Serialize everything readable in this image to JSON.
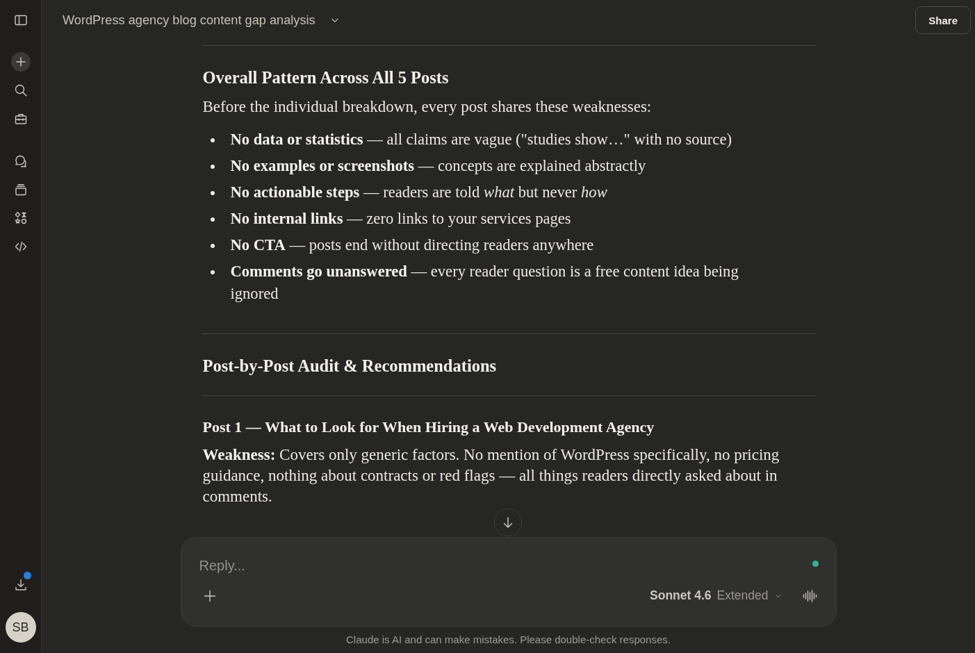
{
  "sidebar": {
    "download_notification": true,
    "avatar": {
      "initials": "SB"
    }
  },
  "header": {
    "title": "WordPress agency blog content gap analysis",
    "share_button": "Share"
  },
  "content": [
    {
      "kind": "rule"
    },
    {
      "kind": "heading",
      "text": "Overall Pattern Across All 5 Posts"
    },
    {
      "kind": "paragraph",
      "text": "Before the individual breakdown, every post shares these weaknesses:"
    },
    {
      "kind": "bullets",
      "items": [
        "**No data or statistics** — all claims are vague (\"studies show…\" with no source)",
        "**No examples or screenshots** — concepts are explained abstractly",
        "**No actionable steps** — readers are told *what* but never *how*",
        "**No internal links** — zero links to your services pages",
        "**No CTA** — posts end without directing readers anywhere",
        "**Comments go unanswered** — every reader question is a free content idea being ignored"
      ]
    },
    {
      "kind": "rule"
    },
    {
      "kind": "heading",
      "text": "Post-by-Post Audit & Recommendations"
    },
    {
      "kind": "rule"
    },
    {
      "kind": "subheading",
      "text": "Post 1 — What to Look for When Hiring a Web Development Agency"
    },
    {
      "kind": "paragraph",
      "text": "**Weakness:** Covers only generic factors. No mention of WordPress specifically, no pricing guidance, nothing about contracts or red flags — all things readers directly asked about in comments."
    }
  ],
  "composer": {
    "placeholder": "Reply...",
    "model": "Sonnet 4.6",
    "mode": "Extended"
  },
  "disclaimer": "Claude is AI and can make mistakes. Please double-check responses."
}
